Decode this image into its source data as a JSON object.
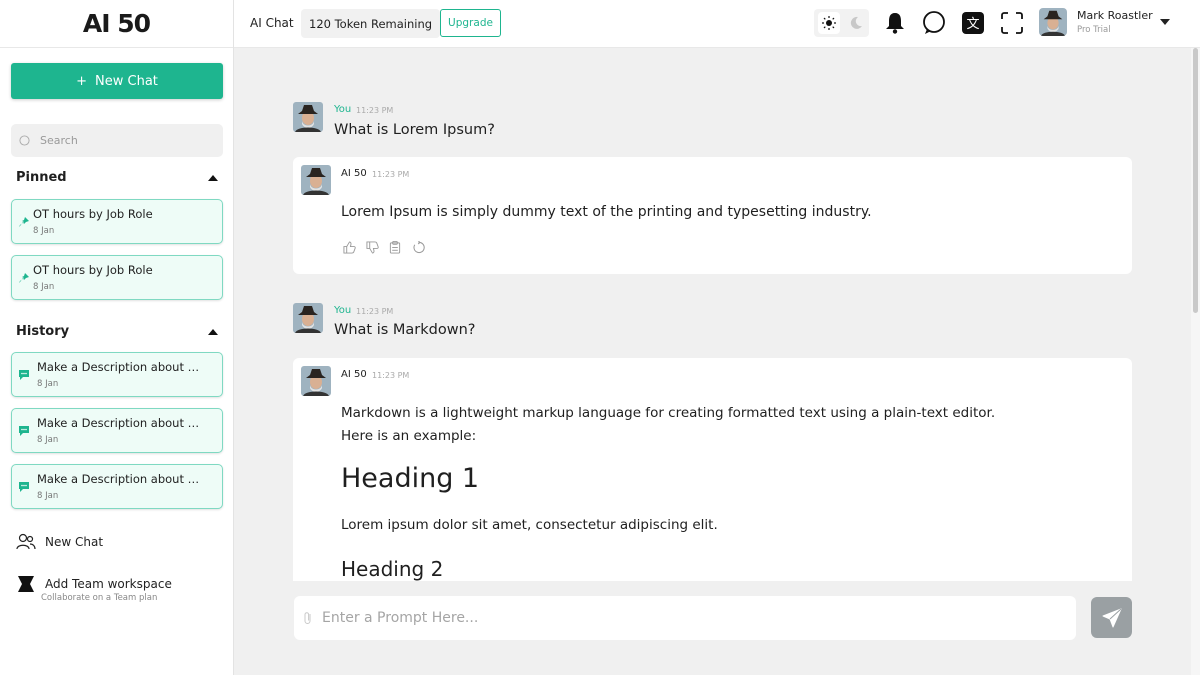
{
  "brand": {
    "logo": "AI 50"
  },
  "sidebar": {
    "new_chat_label": "New Chat",
    "new_chat_plus": "+",
    "search_placeholder": "Search",
    "pinned_title": "Pinned",
    "pinned": [
      {
        "title": "OT hours by Job Role",
        "date": "8 Jan"
      },
      {
        "title": "OT hours by Job Role",
        "date": "8 Jan"
      }
    ],
    "history_title": "History",
    "history": [
      {
        "title": "Make a Description about t...",
        "date": "8 Jan"
      },
      {
        "title": "Make a Description about t...",
        "date": "8 Jan"
      },
      {
        "title": "Make a Description about t...",
        "date": "8 Jan"
      }
    ],
    "new_chat_link": "New Chat",
    "team_link": "Add Team workspace",
    "team_sub": "Collaborate on a Team plan"
  },
  "topbar": {
    "title": "AI Chat",
    "tokens": "120 Token Remaining",
    "upgrade": "Upgrade",
    "user_name": "Mark Roastler",
    "user_plan": "Pro Trial"
  },
  "chat": {
    "messages": [
      {
        "author": "You",
        "time": "11:23 PM",
        "text": "What is Lorem Ipsum?"
      },
      {
        "author": "AI 50",
        "time": "11:23 PM",
        "text": "Lorem Ipsum is simply dummy text of the printing and typesetting industry."
      },
      {
        "author": "You",
        "time": "11:23 PM",
        "text": "What is Markdown?"
      },
      {
        "author": "AI 50",
        "time": "11:23 PM",
        "text1": "Markdown is a lightweight markup language for creating formatted text using a plain-text editor.",
        "text2": "Here is an example:",
        "h1": "Heading 1",
        "p": "Lorem ipsum dolor sit amet, consectetur adipiscing elit.",
        "h2": "Heading 2"
      }
    ]
  },
  "prompt": {
    "placeholder": "Enter a Prompt Here..."
  },
  "colors": {
    "accent": "#1eb58f",
    "send": "#9aa0a3"
  }
}
